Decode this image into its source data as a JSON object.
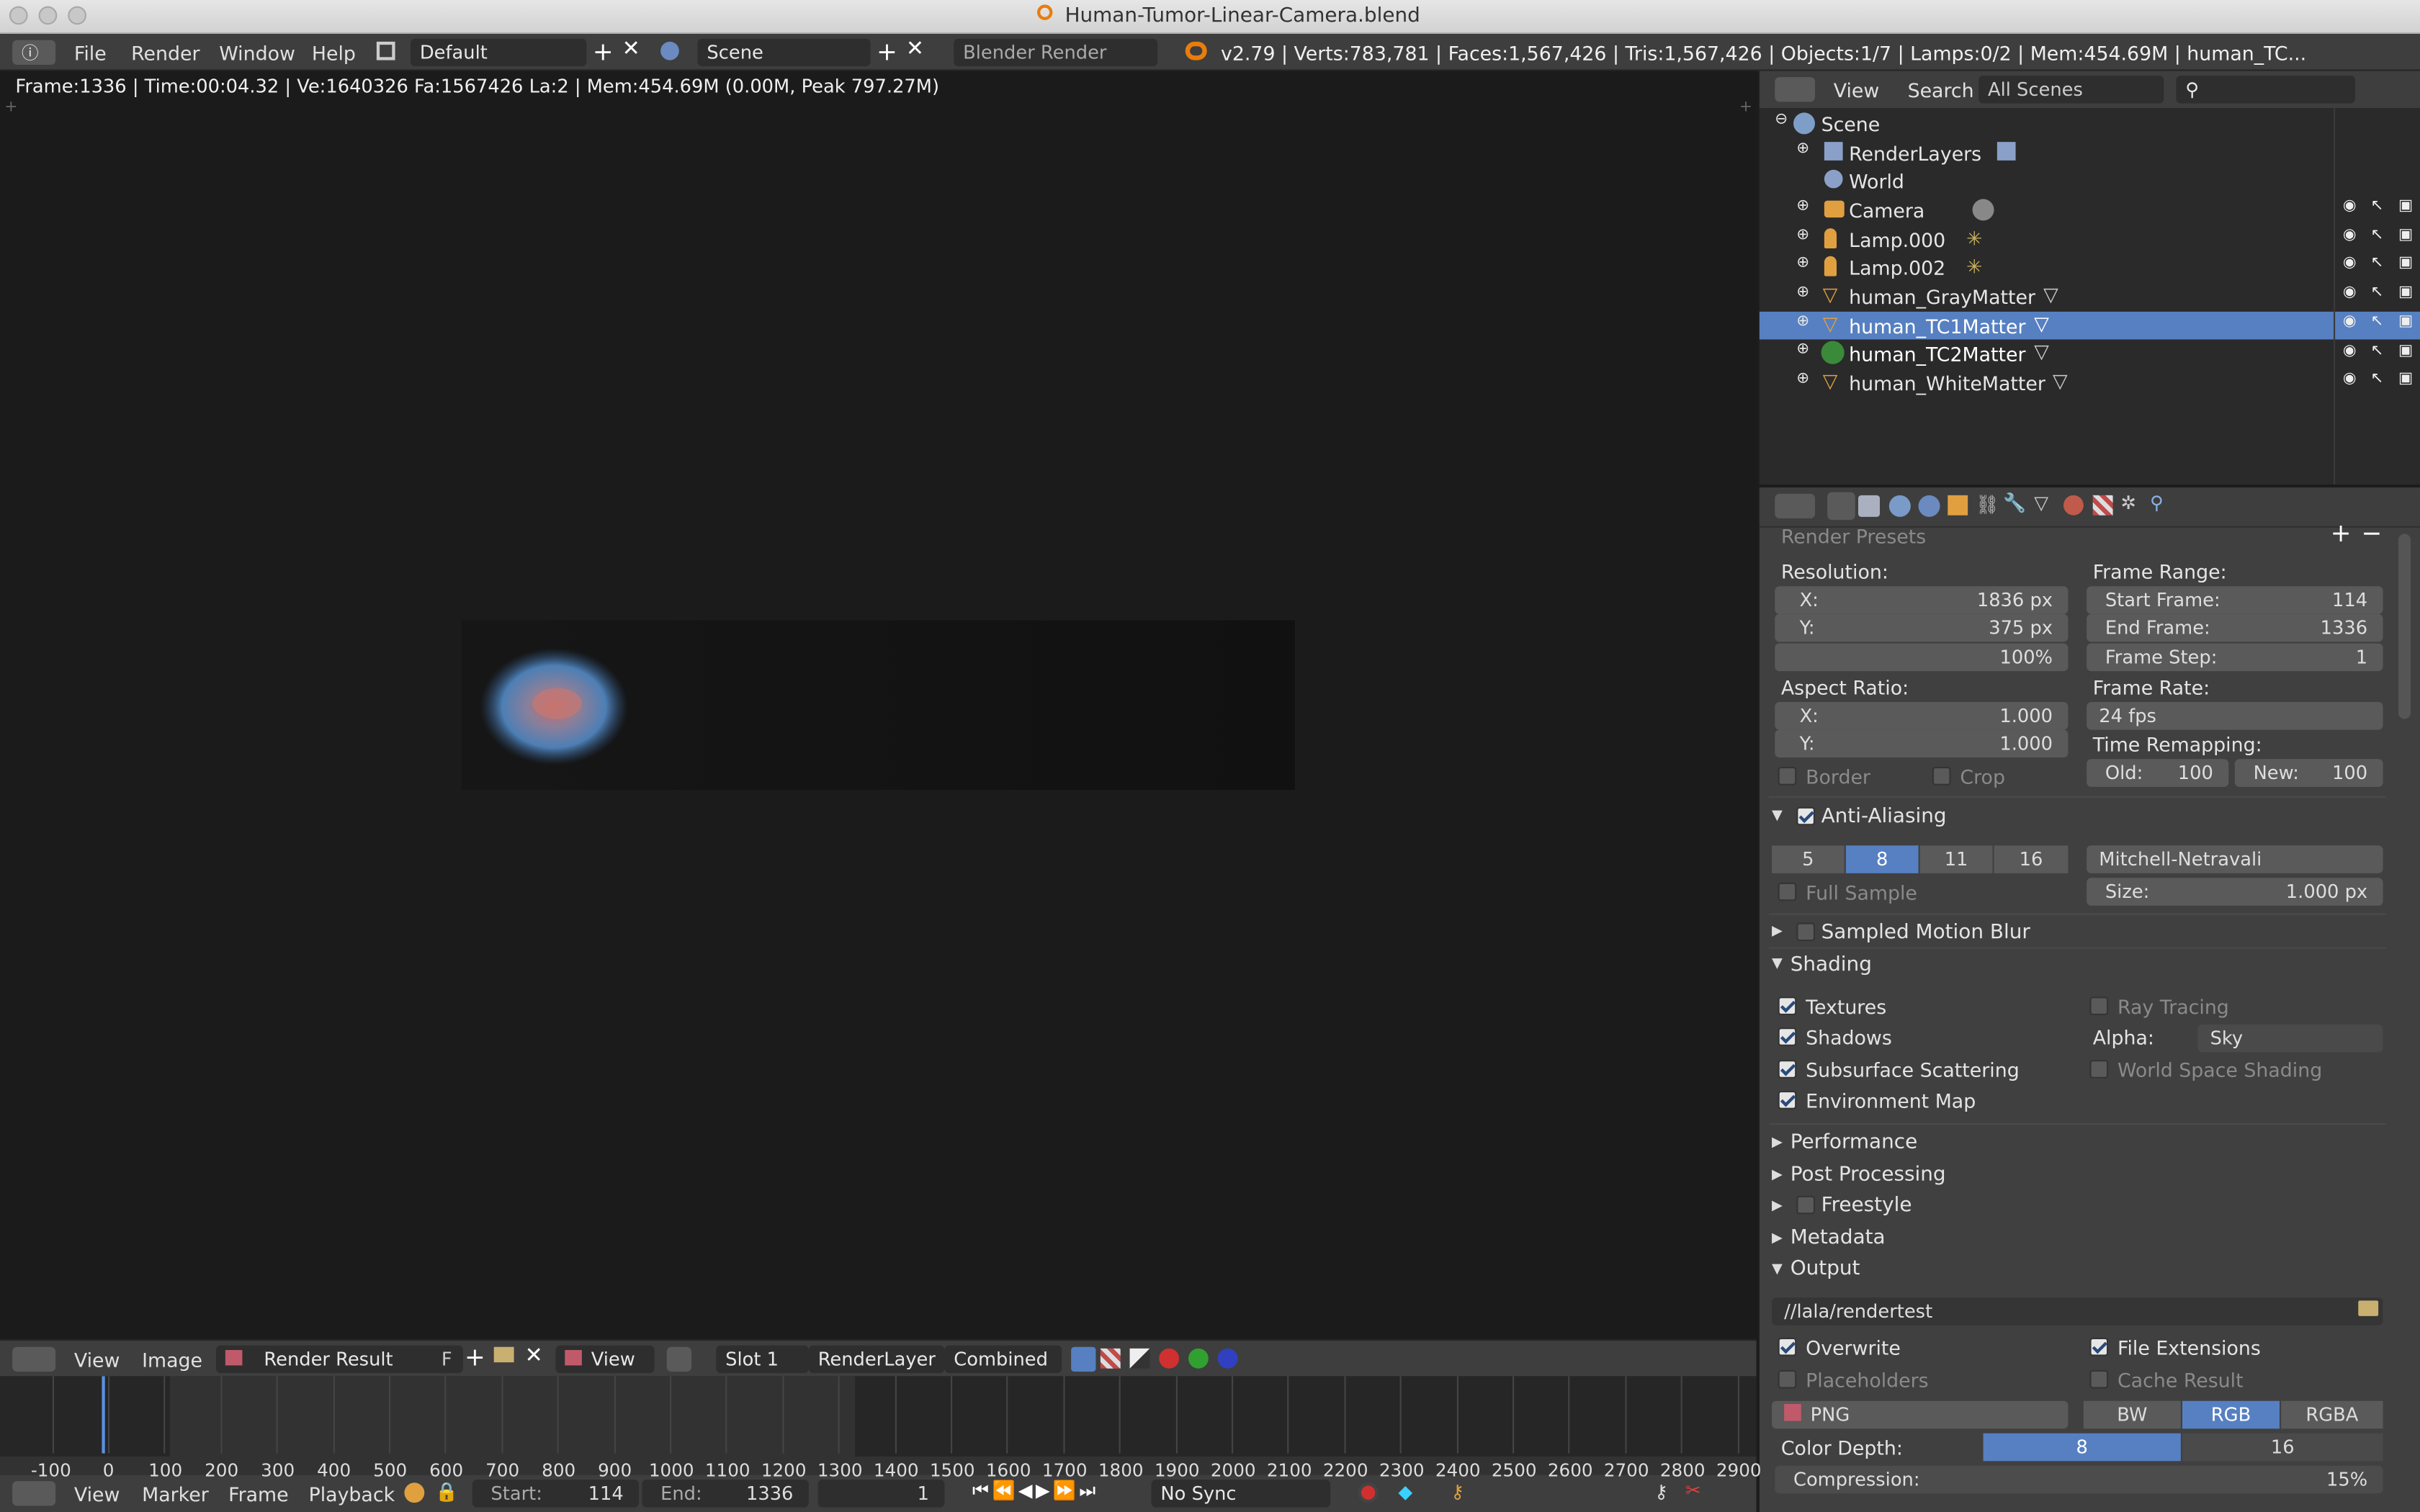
{
  "window": {
    "title": "Human-Tumor-Linear-Camera.blend"
  },
  "topbar": {
    "menus": [
      "File",
      "Render",
      "Window",
      "Help"
    ],
    "screen_layout": "Default",
    "scene": "Scene",
    "engine": "Blender Render",
    "stats": "v2.79 | Verts:783,781 | Faces:1,567,426 | Tris:1,567,426 | Objects:1/7 | Lamps:0/2 | Mem:454.69M | human_TC..."
  },
  "viewport": {
    "info": "Frame:1336 | Time:00:04.32 | Ve:1640326 Fa:1567426 La:2 | Mem:454.69M (0.00M, Peak 797.27M)"
  },
  "outliner": {
    "menus": [
      "View",
      "Search"
    ],
    "display_mode": "All Scenes",
    "items": [
      {
        "label": "Scene"
      },
      {
        "label": "RenderLayers"
      },
      {
        "label": "World"
      },
      {
        "label": "Camera"
      },
      {
        "label": "Lamp.000"
      },
      {
        "label": "Lamp.002"
      },
      {
        "label": "human_GrayMatter"
      },
      {
        "label": "human_TC1Matter"
      },
      {
        "label": "human_TC2Matter"
      },
      {
        "label": "human_WhiteMatter"
      }
    ]
  },
  "properties": {
    "render_presets": "Render Presets",
    "resolution_label": "Resolution:",
    "res_x_label": "X:",
    "res_x": "1836 px",
    "res_y_label": "Y:",
    "res_y": "375 px",
    "res_pct": "100%",
    "aspect_label": "Aspect Ratio:",
    "aspect_x_label": "X:",
    "aspect_x": "1.000",
    "aspect_y_label": "Y:",
    "aspect_y": "1.000",
    "border": "Border",
    "crop": "Crop",
    "frame_range_label": "Frame Range:",
    "start_label": "Start Frame:",
    "start": "114",
    "end_label": "End Frame:",
    "end": "1336",
    "step_label": "Frame Step:",
    "step": "1",
    "frame_rate_label": "Frame Rate:",
    "frame_rate": "24 fps",
    "time_remap_label": "Time Remapping:",
    "old_label": "Old:",
    "old": "100",
    "new_label": "New:",
    "new": "100",
    "anti_aliasing": "Anti-Aliasing",
    "aa_samples": [
      "5",
      "8",
      "11",
      "16"
    ],
    "aa_filter": "Mitchell-Netravali",
    "full_sample": "Full Sample",
    "size_label": "Size:",
    "size": "1.000 px",
    "motion_blur": "Sampled Motion Blur",
    "shading": "Shading",
    "textures": "Textures",
    "shadows": "Shadows",
    "sss": "Subsurface Scattering",
    "env_map": "Environment Map",
    "ray_tracing": "Ray Tracing",
    "alpha_label": "Alpha:",
    "alpha": "Sky",
    "world_space": "World Space Shading",
    "performance": "Performance",
    "post_processing": "Post Processing",
    "freestyle": "Freestyle",
    "metadata": "Metadata",
    "output": "Output",
    "output_path": "//lala/rendertest",
    "overwrite": "Overwrite",
    "file_ext": "File Extensions",
    "placeholders": "Placeholders",
    "cache_result": "Cache Result",
    "format": "PNG",
    "color_modes": [
      "BW",
      "RGB",
      "RGBA"
    ],
    "color_depth_label": "Color Depth:",
    "color_depths": [
      "8",
      "16"
    ],
    "compression_label": "Compression:",
    "compression": "15%"
  },
  "image_editor": {
    "menus": [
      "View",
      "Image"
    ],
    "image": "Render Result",
    "fake_user": "F",
    "view": "View",
    "slot": "Slot 1",
    "layer": "RenderLayer",
    "pass": "Combined"
  },
  "timeline": {
    "ticks": [
      "-100",
      "0",
      "100",
      "200",
      "300",
      "400",
      "500",
      "600",
      "700",
      "800",
      "900",
      "1000",
      "1100",
      "1200",
      "1300",
      "1400",
      "1500",
      "1600",
      "1700",
      "1800",
      "1900",
      "2000",
      "2100",
      "2200",
      "2300",
      "2400",
      "2500",
      "2600",
      "2700",
      "2800",
      "2900"
    ],
    "menus": [
      "View",
      "Marker",
      "Frame",
      "Playback"
    ],
    "start_label": "Start:",
    "start": "114",
    "end_label": "End:",
    "end": "1336",
    "current": "1",
    "sync": "No Sync"
  }
}
